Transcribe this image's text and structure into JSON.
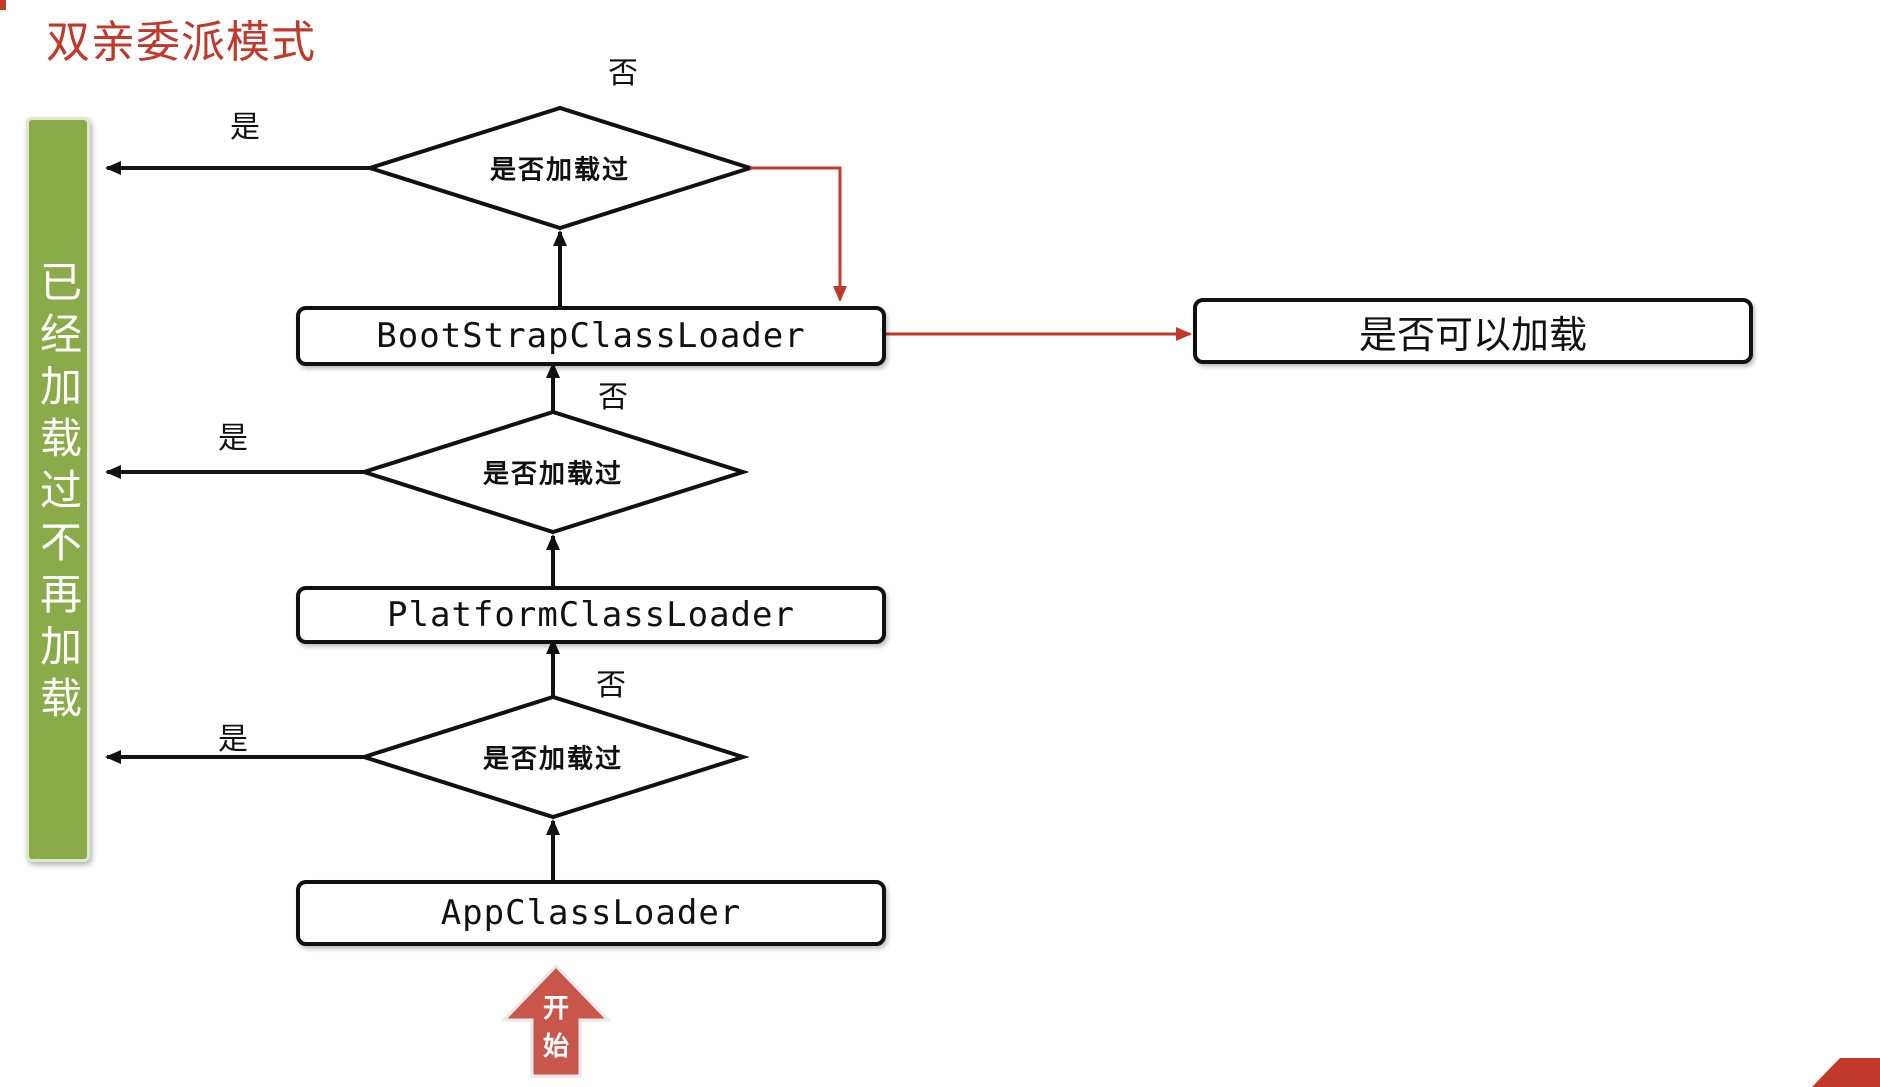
{
  "title": "双亲委派模式",
  "side_bar_text": "已经加载过不再加载",
  "loaders": {
    "bootstrap": "BootStrapClassLoader",
    "platform": "PlatformClassLoader",
    "app": "AppClassLoader"
  },
  "can_load_box": "是否可以加载",
  "decision_label": "是否加载过",
  "yes_label": "是",
  "no_label": "否",
  "start_label": "开始",
  "colors": {
    "title": "#c0392b",
    "green_bar": "#8aab4a",
    "red_arrow": "#c0392b",
    "start_arrow": "#c9564b"
  }
}
